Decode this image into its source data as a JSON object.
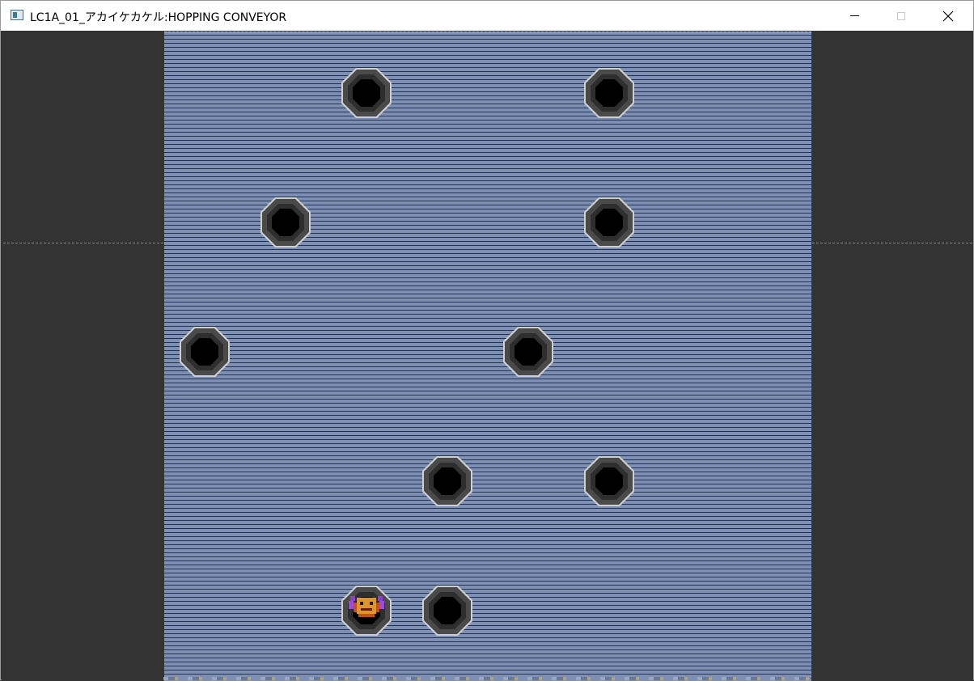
{
  "window": {
    "title": "LC1A_01_アカイケカケル:HOPPING CONVEYOR",
    "icon": "app-window-icon"
  },
  "caption_buttons": {
    "minimize": "minimize-icon",
    "maximize": "maximize-icon",
    "close": "close-icon"
  },
  "colors": {
    "background": "#333333",
    "conveyor": "#7d8fb4",
    "conveyor_stripe": "#24344e",
    "hole_rim": "#cfcfcf",
    "hole_ring_outer": "#4a4a4a",
    "hole_ring_inner": "#2e2e2e",
    "hole_center": "#000000"
  },
  "game": {
    "holes": [
      {
        "col": 2,
        "row": 0
      },
      {
        "col": 5,
        "row": 0
      },
      {
        "col": 1,
        "row": 1
      },
      {
        "col": 5,
        "row": 1
      },
      {
        "col": 0,
        "row": 2
      },
      {
        "col": 4,
        "row": 2
      },
      {
        "col": 3,
        "row": 3
      },
      {
        "col": 5,
        "row": 3
      },
      {
        "col": 2,
        "row": 4
      },
      {
        "col": 3,
        "row": 4
      }
    ],
    "player": {
      "col": 2,
      "row": 4,
      "icon": "player-character-icon"
    }
  }
}
